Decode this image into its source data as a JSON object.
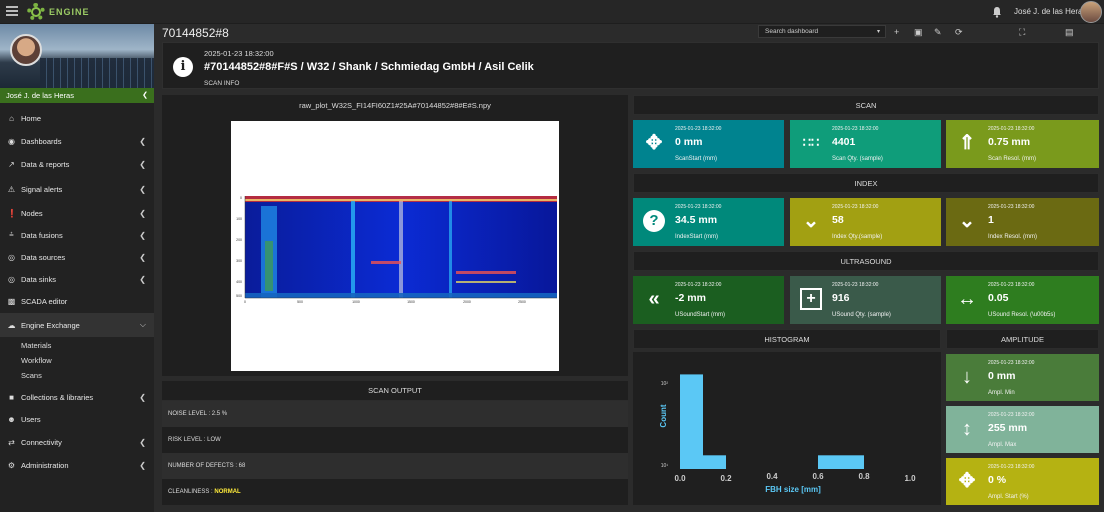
{
  "topbar": {
    "logo_text": "ENGINE",
    "user_name": "José J. de las Heras"
  },
  "sidebar": {
    "profile_name": "José J. de las Heras",
    "items": [
      {
        "label": "Home",
        "icon": "home-icon"
      },
      {
        "label": "Dashboards",
        "icon": "dashboard-icon"
      },
      {
        "label": "Data & reports",
        "icon": "chart-line-icon"
      },
      {
        "label": "Signal alerts",
        "icon": "warning-icon"
      },
      {
        "label": "Nodes",
        "icon": "nodes-icon"
      },
      {
        "label": "Data fusions",
        "icon": "fusion-icon"
      },
      {
        "label": "Data sources",
        "icon": "source-icon"
      },
      {
        "label": "Data sinks",
        "icon": "sink-icon"
      },
      {
        "label": "SCADA editor",
        "icon": "scada-icon"
      },
      {
        "label": "Engine Exchange",
        "icon": "exchange-icon"
      },
      {
        "label": "Materials",
        "icon": ""
      },
      {
        "label": "Workflow",
        "icon": ""
      },
      {
        "label": "Scans",
        "icon": ""
      },
      {
        "label": "Collections & libraries",
        "icon": "collections-icon"
      },
      {
        "label": "Users",
        "icon": "users-icon"
      },
      {
        "label": "Connectivity",
        "icon": "connectivity-icon"
      },
      {
        "label": "Administration",
        "icon": "admin-icon"
      }
    ]
  },
  "page": {
    "title": "70144852#8",
    "search_placeholder": "Search dashboard"
  },
  "info": {
    "timestamp": "2025-01-23 18:32:00",
    "heading": "#70144852#8#F#S / W32 / Shank / Schmiedag GmbH / Asil Celik",
    "subtitle": "SCAN INFO"
  },
  "plot": {
    "filename": "raw_plot_W32S_FI14FI60Z1#25A#70144852#8#E#S.npy",
    "y_ticks": [
      "0",
      "100",
      "200",
      "300",
      "400",
      "500"
    ],
    "x_ticks": [
      "0",
      "500",
      "1000",
      "1500",
      "2000",
      "2500"
    ]
  },
  "scan_output": {
    "header": "SCAN OUTPUT",
    "noise_level": "NOISE LEVEL : 2.5 %",
    "risk_level": "RISK LEVEL : LOW",
    "defects": "NUMBER OF DEFECTS : 68",
    "cleanliness_label": "CLEANLINESS : ",
    "cleanliness_value": "NORMAL"
  },
  "sections": {
    "scan": "SCAN",
    "index": "INDEX",
    "ultrasound": "ULTRASOUND",
    "histogram": "HISTOGRAM",
    "amplitude": "AMPLITUDE"
  },
  "cards": {
    "scan_start": {
      "ts": "2025-01-23 18:32:00",
      "value": "0 mm",
      "label": "ScanStart (mm)",
      "color": "#00838f"
    },
    "scan_qty": {
      "ts": "2025-01-23 18:32:00",
      "value": "4401",
      "label": "Scan Qty. (sample)",
      "color": "#0f9d7a"
    },
    "scan_resol": {
      "ts": "2025-01-23 18:32:00",
      "value": "0.75 mm",
      "label": "Scan Resol. (mm)",
      "color": "#7a9a1c"
    },
    "index_start": {
      "ts": "2025-01-23 18:32:00",
      "value": "34.5 mm",
      "label": "IndexStart (mm)",
      "color": "#00897b"
    },
    "index_qty": {
      "ts": "2025-01-23 18:32:00",
      "value": "58",
      "label": "Index Qty.(sample)",
      "color": "#a2a012"
    },
    "index_resol": {
      "ts": "2025-01-23 18:32:00",
      "value": "1",
      "label": "Index Resol. (mm)",
      "color": "#6b6a12"
    },
    "usound_start": {
      "ts": "2025-01-23 18:32:00",
      "value": "-2 mm",
      "label": "USoundStart (mm)",
      "color": "#1b5e20"
    },
    "usound_qty": {
      "ts": "2025-01-23 18:32:00",
      "value": "916",
      "label": "USound Qty. (sample)",
      "color": "#3a5a4a"
    },
    "usound_resol": {
      "ts": "2025-01-23 18:32:00",
      "value": "0.05",
      "label": "USound Resol. (\\u00b5s)",
      "color": "#2e7d1f"
    },
    "ampl_min": {
      "ts": "2025-01-23 18:32:00",
      "value": "0 mm",
      "label": "Ampl. Min",
      "color": "#4a7c3a"
    },
    "ampl_max": {
      "ts": "2025-01-23 18:32:00",
      "value": "255 mm",
      "label": "Ampl. Max",
      "color": "#80b39a"
    },
    "ampl_start": {
      "ts": "2025-01-23 18:32:00",
      "value": "0 %",
      "label": "Ampl. Start (%)",
      "color": "#b5b212"
    }
  },
  "chart_data": {
    "type": "bar",
    "ylabel": "Count",
    "xlabel": "FBH size [mm]",
    "x_ticks": [
      "0.0",
      "0.2",
      "0.4",
      "0.6",
      "0.8",
      "1.0"
    ],
    "y_ticks": [
      "10²",
      "10¹"
    ],
    "y_log": true,
    "xlim": [
      0,
      1
    ],
    "bins": [
      {
        "start": 0.0,
        "end": 0.1,
        "count": 120
      },
      {
        "start": 0.1,
        "end": 0.2,
        "count": 2
      },
      {
        "start": 0.6,
        "end": 0.8,
        "count": 2
      }
    ],
    "bar_color": "#5bc8f5",
    "ylim": [
      1,
      150
    ]
  }
}
